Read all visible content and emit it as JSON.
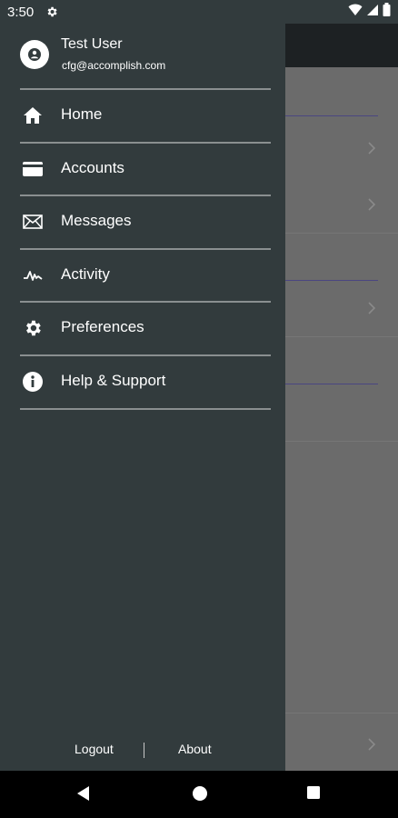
{
  "status_bar": {
    "time": "3:50"
  },
  "drawer": {
    "profile": {
      "name": "Test User",
      "email": "cfg@accomplish.com"
    },
    "menu": [
      {
        "label": "Home",
        "icon": "home-icon"
      },
      {
        "label": "Accounts",
        "icon": "card-icon"
      },
      {
        "label": "Messages",
        "icon": "mail-icon"
      },
      {
        "label": "Activity",
        "icon": "activity-icon"
      },
      {
        "label": "Preferences",
        "icon": "gear-icon"
      },
      {
        "label": "Help & Support",
        "icon": "info-icon"
      }
    ],
    "footer": {
      "logout": "Logout",
      "about": "About"
    }
  },
  "colors": {
    "drawer_bg": "#323b3d",
    "scrim": "#6b6b6b",
    "separator": "#8a8f90",
    "accent_line": "#4a4680"
  }
}
